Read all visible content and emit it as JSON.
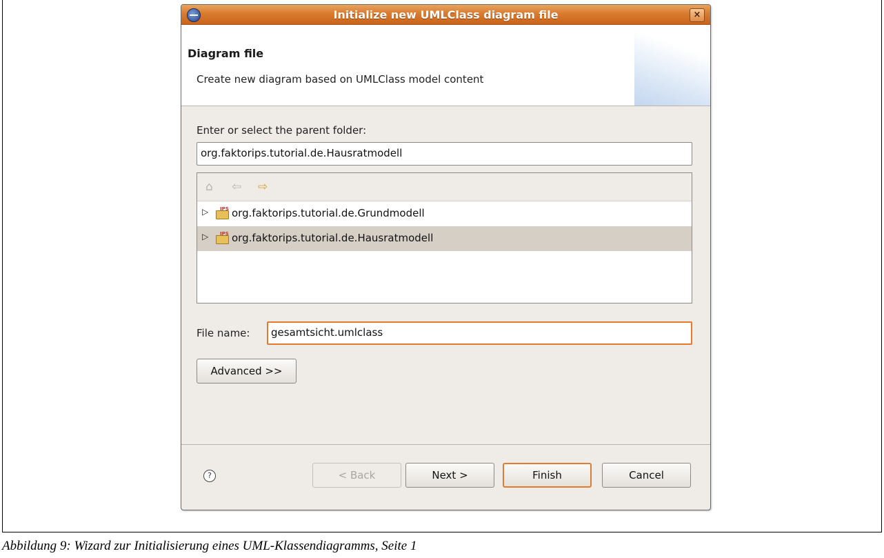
{
  "window": {
    "title": "Initialize new UMLClass diagram file",
    "close_glyph": "×"
  },
  "header": {
    "title": "Diagram file",
    "description": "Create new diagram based on UMLClass model content"
  },
  "folder": {
    "label": "Enter or select the parent folder:",
    "value": "org.faktorips.tutorial.de.Hausratmodell",
    "tree_items": [
      {
        "label": "org.faktorips.tutorial.de.Grundmodell",
        "selected": false
      },
      {
        "label": "org.faktorips.tutorial.de.Hausratmodell",
        "selected": true
      }
    ],
    "toolbar": {
      "home_glyph": "⌂",
      "back_glyph": "⇦",
      "forward_glyph": "⇨"
    }
  },
  "filename": {
    "label": "File name:",
    "value": "gesamtsicht.umlclass"
  },
  "advanced_label": "Advanced >>",
  "buttons": {
    "help_glyph": "?",
    "back": "< Back",
    "next": "Next >",
    "finish": "Finish",
    "cancel": "Cancel"
  },
  "caption": "Abbildung 9: Wizard zur Initialisierung eines UML-Klassendiagramms, Seite 1",
  "colors": {
    "accent": "#e07b30",
    "titlebar": "#d97b2e",
    "dialog_bg": "#efebe7",
    "selection": "#d6cfc5"
  }
}
